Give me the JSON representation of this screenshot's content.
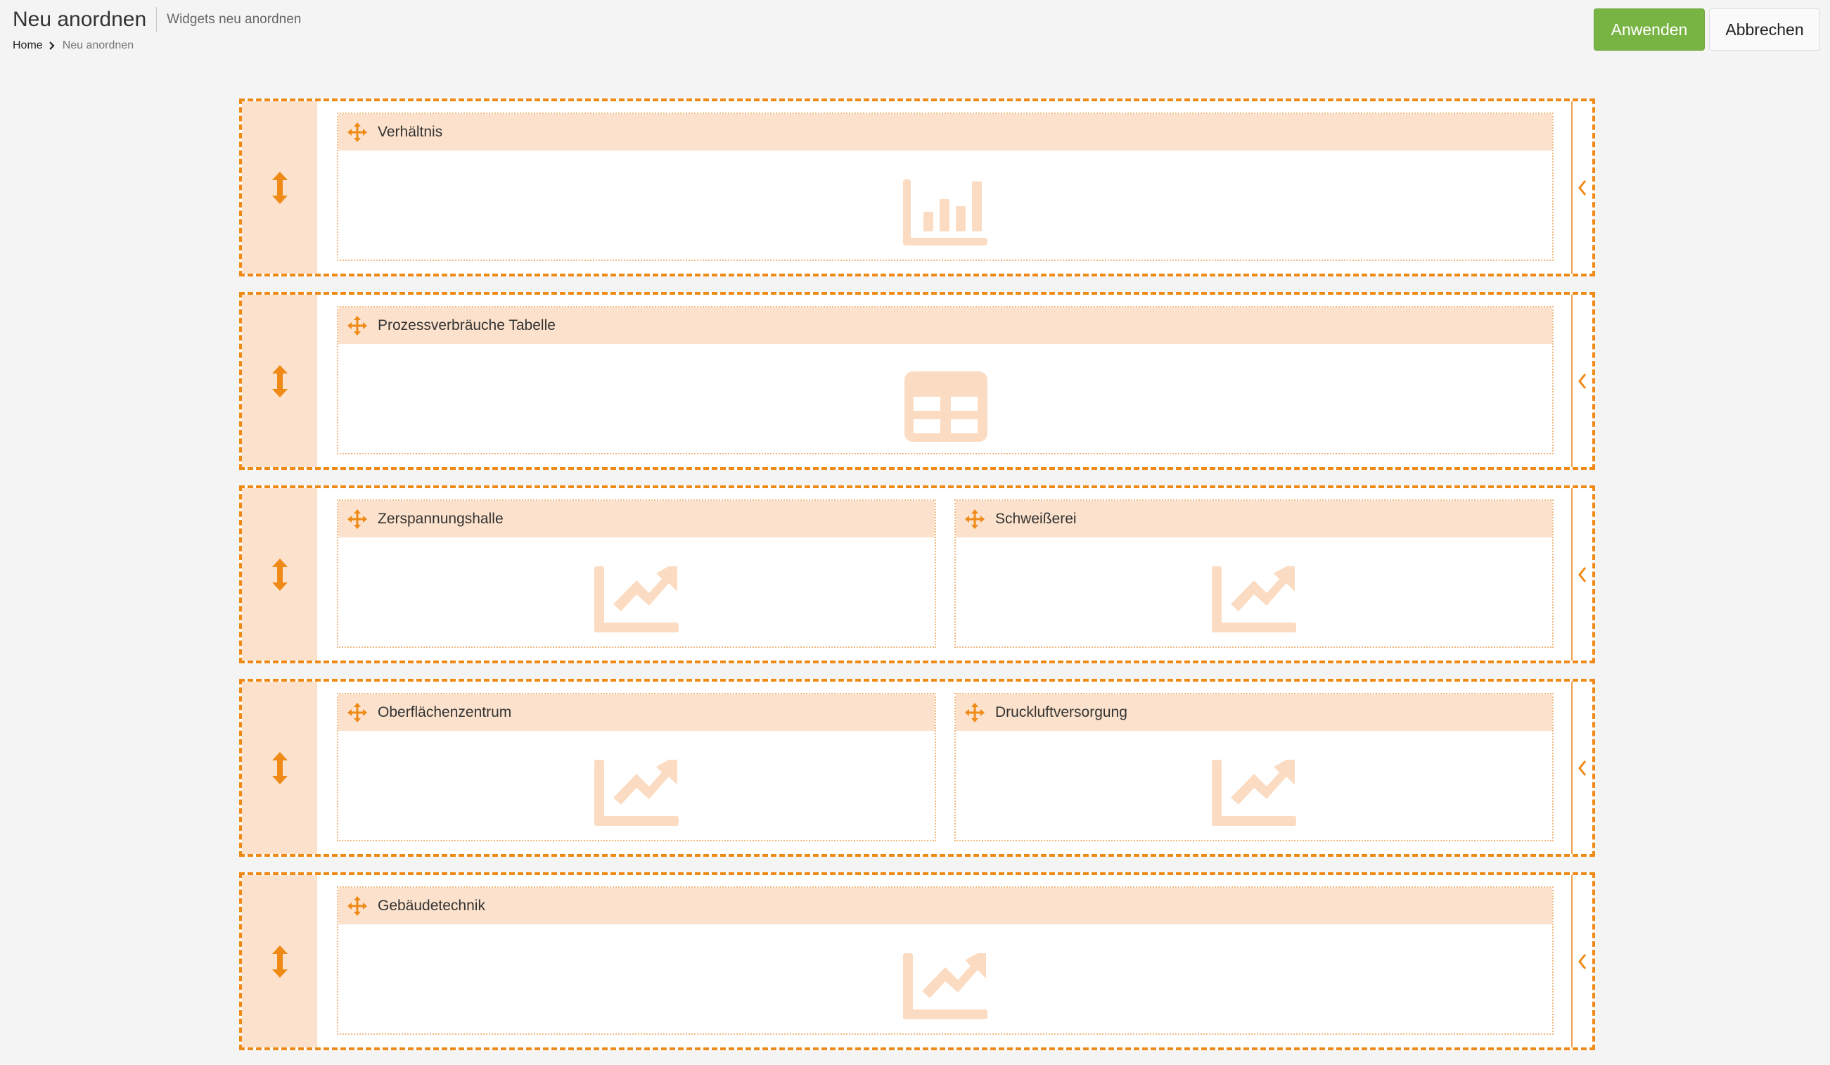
{
  "header": {
    "title": "Neu anordnen",
    "subtitle": "Widgets neu anordnen",
    "breadcrumb": {
      "home": "Home",
      "current": "Neu anordnen"
    },
    "apply_label": "Anwenden",
    "cancel_label": "Abbrechen"
  },
  "colors": {
    "accent": "#ef8a17",
    "handle_bg": "#fce2cc",
    "apply_bg": "#78b443",
    "placeholder_icon": "#fbdcc2"
  },
  "rows": [
    {
      "widgets": [
        {
          "title": "Verhältnis",
          "icon": "bar-chart-icon"
        }
      ]
    },
    {
      "widgets": [
        {
          "title": "Prozessverbräuche Tabelle",
          "icon": "table-icon"
        }
      ]
    },
    {
      "widgets": [
        {
          "title": "Zerspannungshalle",
          "icon": "line-chart-icon"
        },
        {
          "title": "Schweißerei",
          "icon": "line-chart-icon"
        }
      ]
    },
    {
      "widgets": [
        {
          "title": "Oberflächenzentrum",
          "icon": "line-chart-icon"
        },
        {
          "title": "Druckluftversorgung",
          "icon": "line-chart-icon"
        }
      ]
    },
    {
      "widgets": [
        {
          "title": "Gebäudetechnik",
          "icon": "line-chart-icon"
        }
      ]
    }
  ]
}
